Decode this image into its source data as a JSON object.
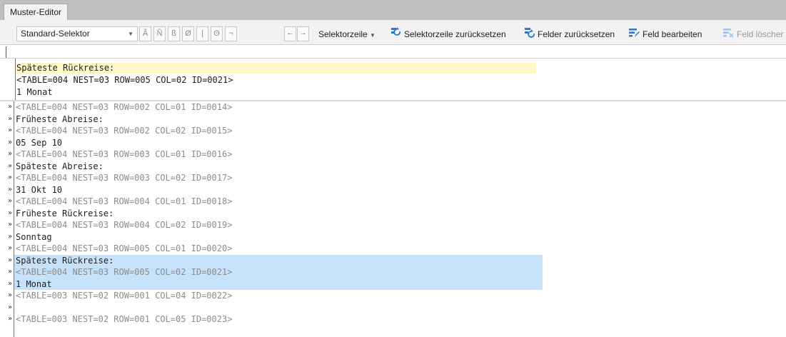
{
  "document_tab": "Muster-Editor",
  "toolbar": {
    "selector_value": "Standard-Selektor",
    "symbols": [
      "Ã",
      "Ñ",
      "ß",
      "Ø",
      "|",
      "Θ",
      "¬"
    ],
    "selektorzeile_label": "Selektorzeile",
    "reset_selector_label": "Selektorzeile zurücksetzen",
    "reset_fields_label": "Felder zurücksetzen",
    "edit_field_label": "Feld bearbeiten",
    "delete_field_label": "Feld löscher"
  },
  "preview": {
    "line1": "Späteste Rückreise:",
    "line2": "<TABLE=004 NEST=03 ROW=005 COL=02 ID=0021>",
    "line3": "1 Monat"
  },
  "lines": [
    {
      "text": "<TABLE=004 NEST=03 ROW=002 COL=01 ID=0014>",
      "kind": "tag"
    },
    {
      "text": "Früheste Abreise:",
      "kind": "val"
    },
    {
      "text": "<TABLE=004 NEST=03 ROW=002 COL=02 ID=0015>",
      "kind": "tag"
    },
    {
      "text": "05 Sep 10",
      "kind": "val"
    },
    {
      "text": "<TABLE=004 NEST=03 ROW=003 COL=01 ID=0016>",
      "kind": "tag"
    },
    {
      "text": "Späteste Abreise:",
      "kind": "val"
    },
    {
      "text": "<TABLE=004 NEST=03 ROW=003 COL=02 ID=0017>",
      "kind": "tag"
    },
    {
      "text": "31 Okt 10",
      "kind": "val"
    },
    {
      "text": "<TABLE=004 NEST=03 ROW=004 COL=01 ID=0018>",
      "kind": "tag"
    },
    {
      "text": "Früheste Rückreise:",
      "kind": "val"
    },
    {
      "text": "<TABLE=004 NEST=03 ROW=004 COL=02 ID=0019>",
      "kind": "tag"
    },
    {
      "text": "Sonntag",
      "kind": "val"
    },
    {
      "text": "<TABLE=004 NEST=03 ROW=005 COL=01 ID=0020>",
      "kind": "tag"
    },
    {
      "text": "Späteste Rückreise:",
      "kind": "val"
    },
    {
      "text": "<TABLE=004 NEST=03 ROW=005 COL=02 ID=0021>",
      "kind": "tag"
    },
    {
      "text": "1 Monat",
      "kind": "val"
    },
    {
      "text": "<TABLE=003 NEST=02 ROW=001 COL=04 ID=0022>",
      "kind": "tag"
    },
    {
      "text": "",
      "kind": "val"
    },
    {
      "text": "<TABLE=003 NEST=02 ROW=001 COL=05 ID=0023>",
      "kind": "tag"
    }
  ],
  "selected_range": [
    13,
    15
  ],
  "colors": {
    "selection": "#c6e1fa",
    "preview_highlight": "#fff7c7",
    "tag_text": "#8c8c8c",
    "icon_blue": "#2e75c7"
  }
}
